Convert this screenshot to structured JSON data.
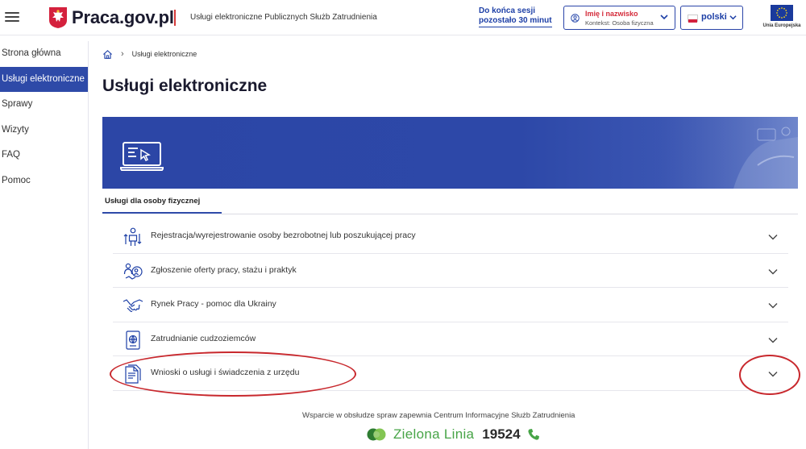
{
  "header": {
    "logo_text": "Praca.gov.pl",
    "subtitle": "Usługi elektroniczne Publicznych Służb Zatrudnienia",
    "session_line1": "Do końca sesji",
    "session_line2": "pozostało 30 minut",
    "user_name": "Imię i nazwisko",
    "user_context": "Kontekst: Osoba fizyczna",
    "language": "polski",
    "eu_label": "Unia Europejska"
  },
  "sidebar": {
    "items": [
      {
        "label": "Strona główna",
        "active": false
      },
      {
        "label": "Usługi elektroniczne",
        "active": true
      },
      {
        "label": "Sprawy",
        "active": false
      },
      {
        "label": "Wizyty",
        "active": false
      },
      {
        "label": "FAQ",
        "active": false
      },
      {
        "label": "Pomoc",
        "active": false
      }
    ]
  },
  "breadcrumb": {
    "current": "Usługi elektroniczne"
  },
  "page": {
    "title": "Usługi elektroniczne",
    "tab_label": "Usługi dla osoby fizycznej"
  },
  "services": [
    {
      "label": "Rejestracja/wyrejestrowanie osoby bezrobotnej lub poszukującej pracy",
      "icon": "person-register-icon"
    },
    {
      "label": "Zgłoszenie oferty pracy, stażu i praktyk",
      "icon": "job-offer-icon"
    },
    {
      "label": "Rynek Pracy - pomoc dla Ukrainy",
      "icon": "handshake-icon"
    },
    {
      "label": "Zatrudnianie cudzoziemców",
      "icon": "passport-icon"
    },
    {
      "label": "Wnioski o usługi i świadczenia z urzędu",
      "icon": "documents-icon"
    }
  ],
  "footer": {
    "support_text": "Wsparcie w obsłudze spraw zapewnia Centrum Informacyjne Służb Zatrudnienia",
    "hotline_name": "Zielona Linia",
    "hotline_number": "19524"
  },
  "colors": {
    "primary": "#2e4aa8",
    "accent_red": "#d42b3a",
    "hotline_green": "#47a447",
    "annotation_red": "#c8282d"
  }
}
